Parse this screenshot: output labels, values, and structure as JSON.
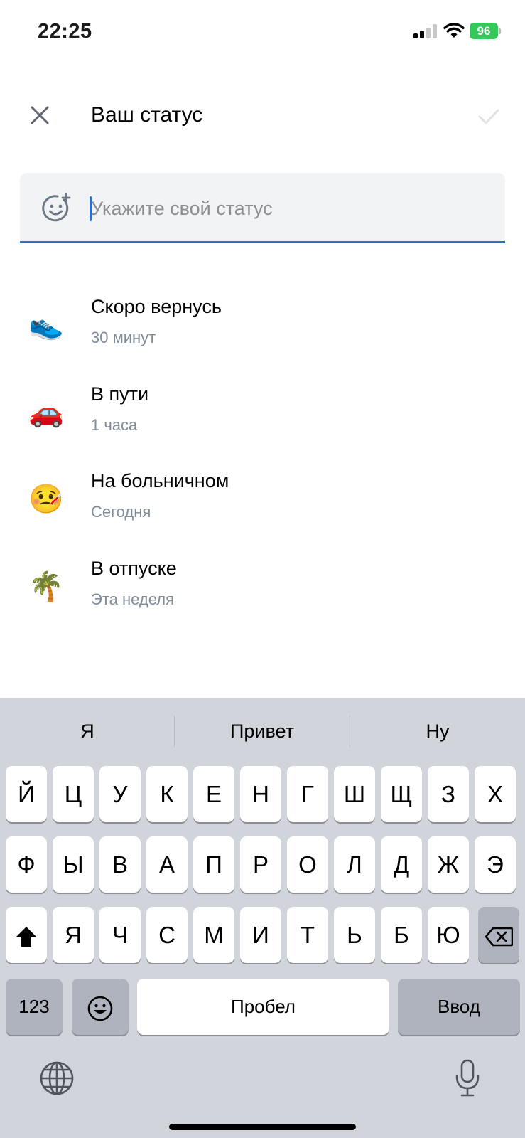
{
  "status_bar": {
    "time": "22:25",
    "battery": "96"
  },
  "header": {
    "title": "Ваш статус"
  },
  "input": {
    "placeholder": "Укажите свой статус"
  },
  "presets": [
    {
      "emoji": "👟",
      "title": "Скоро вернусь",
      "subtitle": "30 минут"
    },
    {
      "emoji": "🚗",
      "title": "В пути",
      "subtitle": "1 часа"
    },
    {
      "emoji": "🤒",
      "title": "На больничном",
      "subtitle": "Сегодня"
    },
    {
      "emoji": "🌴",
      "title": "В отпуске",
      "subtitle": "Эта неделя"
    }
  ],
  "keyboard": {
    "suggestions": [
      "Я",
      "Привет",
      "Ну"
    ],
    "row1": [
      "Й",
      "Ц",
      "У",
      "К",
      "Е",
      "Н",
      "Г",
      "Ш",
      "Щ",
      "З",
      "Х"
    ],
    "row2": [
      "Ф",
      "Ы",
      "В",
      "А",
      "П",
      "Р",
      "О",
      "Л",
      "Д",
      "Ж",
      "Э"
    ],
    "row3": [
      "Я",
      "Ч",
      "С",
      "М",
      "И",
      "Т",
      "Ь",
      "Б",
      "Ю"
    ],
    "numbers_label": "123",
    "space_label": "Пробел",
    "return_label": "Ввод"
  },
  "colors": {
    "accent": "#2f6cc7",
    "battery": "#34c759",
    "keyboard_bg": "#d1d4db"
  }
}
